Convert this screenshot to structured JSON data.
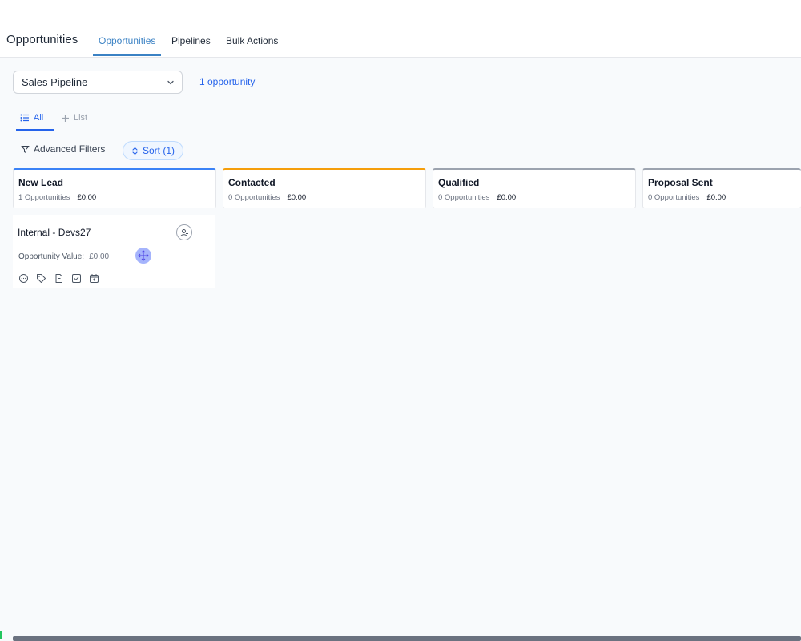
{
  "header": {
    "title": "Opportunities",
    "tabs": [
      {
        "label": "Opportunities",
        "active": true
      },
      {
        "label": "Pipelines",
        "active": false
      },
      {
        "label": "Bulk Actions",
        "active": false
      }
    ]
  },
  "pipeline": {
    "selected": "Sales Pipeline",
    "count_text": "1 opportunity"
  },
  "views": {
    "all": "All",
    "list": "List"
  },
  "filters": {
    "advanced": "Advanced Filters",
    "sort": "Sort (1)"
  },
  "columns": [
    {
      "title": "New Lead",
      "count": "1 Opportunities",
      "amount": "£0.00",
      "color": "#3b82f6"
    },
    {
      "title": "Contacted",
      "count": "0 Opportunities",
      "amount": "£0.00",
      "color": "#f59e0b"
    },
    {
      "title": "Qualified",
      "count": "0 Opportunities",
      "amount": "£0.00",
      "color": "#9ca3af"
    },
    {
      "title": "Proposal Sent",
      "count": "0 Opportunities",
      "amount": "£0.00",
      "color": "#9ca3af"
    }
  ],
  "card": {
    "title": "Internal - Devs27",
    "value_label": "Opportunity Value:",
    "value": "£0.00",
    "icons": [
      "chat-icon",
      "tag-icon",
      "document-icon",
      "checkbox-icon",
      "calendar-icon"
    ]
  },
  "colors": {
    "accent": "#2563eb",
    "header_accent": "#3b82c4"
  }
}
